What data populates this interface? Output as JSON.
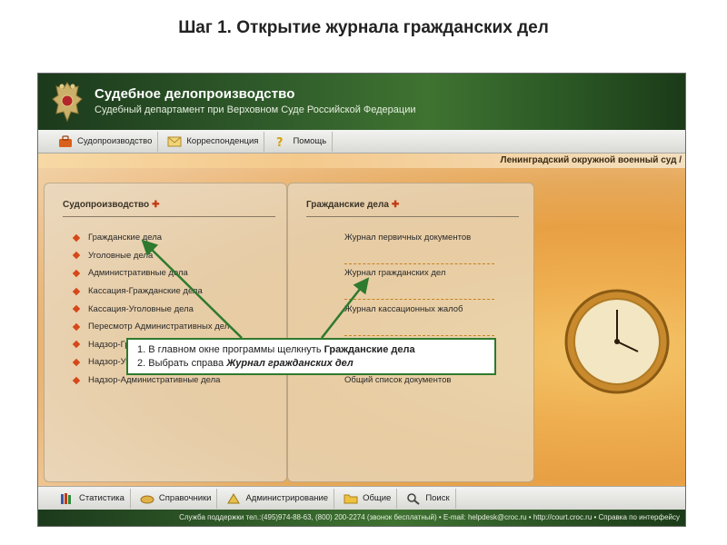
{
  "slide": {
    "title": "Шаг 1. Открытие журнала гражданских дел"
  },
  "app": {
    "title": "Судебное делопроизводство",
    "subtitle": "Судебный департамент при Верховном Суде Российской Федерации"
  },
  "menu": [
    {
      "label": "Судопроизводство",
      "icon": "briefcase-icon"
    },
    {
      "label": "Корреспонденция",
      "icon": "envelope-icon"
    },
    {
      "label": "Помощь",
      "icon": "question-icon"
    }
  ],
  "court_name": "Ленинградский окружной военный суд /",
  "left_panel": {
    "heading": "Судопроизводство",
    "arrow": "✚",
    "items": [
      "Гражданские дела",
      "Уголовные дела",
      "Административные дела",
      "Кассация-Гражданские дела",
      "Кассация-Уголовные дела",
      "Пересмотр Административных дел",
      "Надзор-Гражданские дела",
      "Надзор-Уголовные дела",
      "Надзор-Административные дела"
    ]
  },
  "right_panel": {
    "heading": "Гражданские дела",
    "arrow": "✚",
    "items": [
      "Журнал первичных документов",
      "",
      "Журнал гражданских дел",
      "",
      "Журнал кассационных жалоб",
      "",
      "",
      "",
      "Общий список документов"
    ]
  },
  "bottom_menu": [
    {
      "label": "Статистика",
      "icon": "books-icon"
    },
    {
      "label": "Справочники",
      "icon": "handshake-icon"
    },
    {
      "label": "Администрирование",
      "icon": "admin-icon"
    },
    {
      "label": "Общие",
      "icon": "folder-icon"
    },
    {
      "label": "Поиск",
      "icon": "search-icon"
    }
  ],
  "footer": {
    "text": "Служба поддержки тел.:(495)974-88-63, (800) 200-2274 (звонок бесплатный) • E-mail: helpdesk@croc.ru • http://court.croc.ru • Справка по интерфейсу"
  },
  "callout": {
    "line1_prefix": "1. В главном окне программы щелкнуть ",
    "line1_bold": "Гражданские дела",
    "line2_prefix": "2. Выбрать справа ",
    "line2_bold": "Журнал гражданских дел"
  },
  "colors": {
    "header_green": "#2f5a2a",
    "accent_orange": "#d4481a",
    "callout_border": "#2e7a2e"
  }
}
